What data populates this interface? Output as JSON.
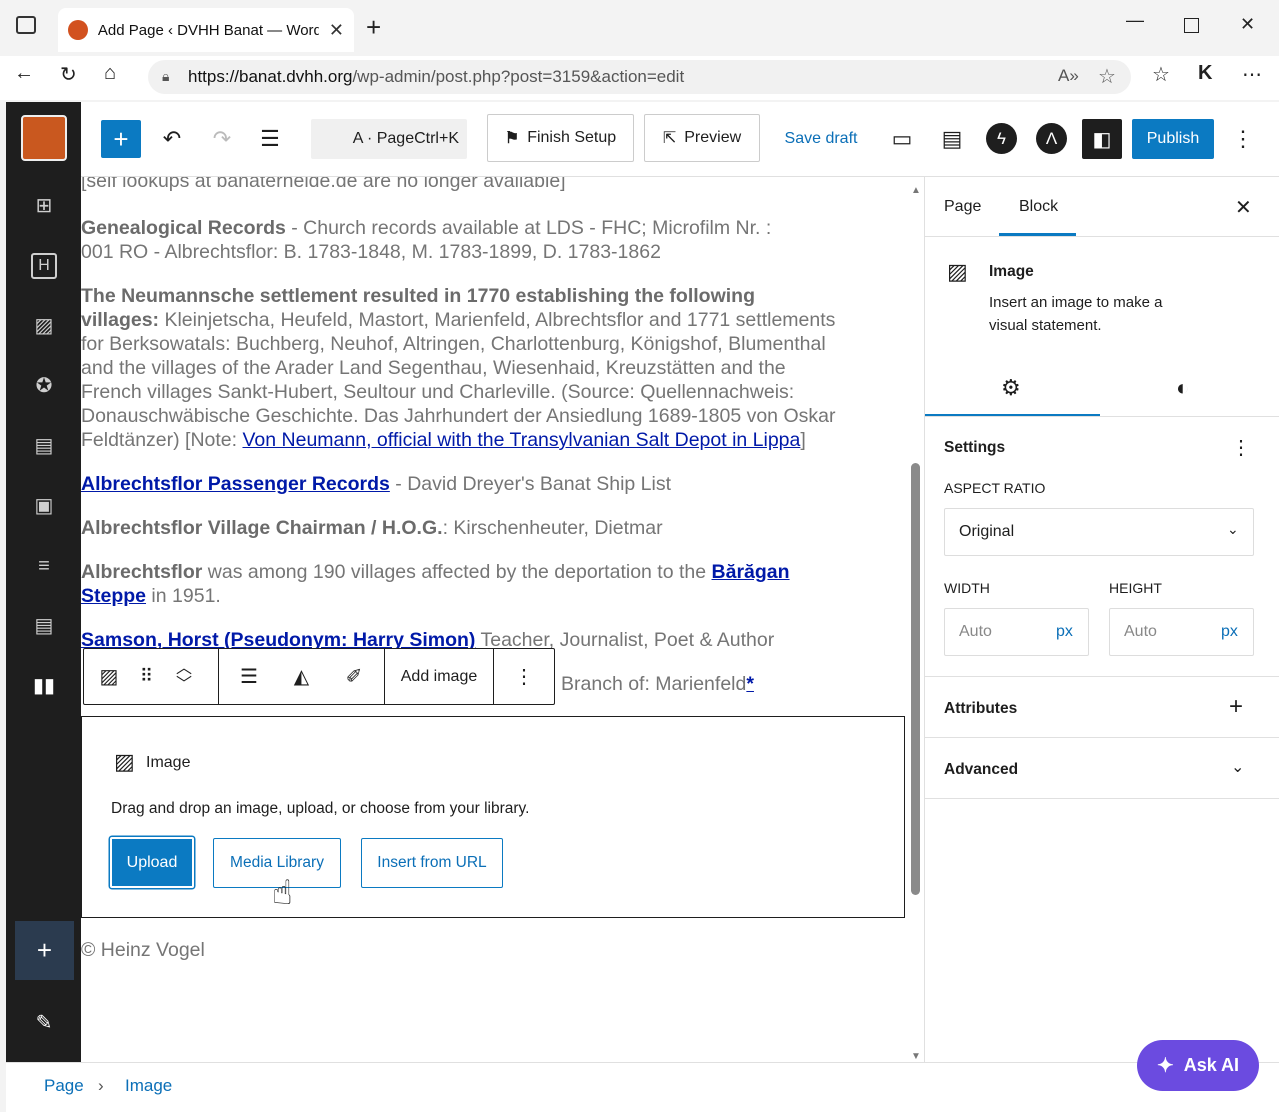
{
  "browser": {
    "tab_title": "Add Page ‹ DVHH Banat — WordPress",
    "url_host": "https://banat.dvhh.org",
    "url_path": "/wp-admin/post.php?post=3159&action=edit"
  },
  "toolbar": {
    "command": "A · PageCtrl+K",
    "finish_setup": "Finish Setup",
    "preview": "Preview",
    "save_draft": "Save draft",
    "publish": "Publish"
  },
  "content": {
    "p0": "[self lookups at banaterheide.de are no longer available]",
    "p1_bold": "Genealogical Records",
    "p1_line1": " - Church records available at LDS - FHC; Microfilm Nr. :",
    "p1_line2": "001 RO - Albrechtsflor: B. 1783-1848, M. 1783-1899, D. 1783-1862",
    "p2_bold1": "The Neumannsche settlement resulted in 1770 establishing the following",
    "p2_bold2": "villages:",
    "p2_text1": " Kleinjetscha, Heufeld, Mastort, Marienfeld, Albrechtsflor and 1771 settlements",
    "p2_text2": "for Berksowatals: Buchberg, Neuhof, Altringen, Charlottenburg, Königshof, Blumenthal",
    "p2_text3": "and the villages of the Arader Land Segenthau, Wiesenhaid, Kreuzstätten and the",
    "p2_text4": "French villages Sankt-Hubert, Seultour und Charleville. (Source: Quellennachweis:",
    "p2_text5": "Donauschwäbische Geschichte. Das Jahrhundert der Ansiedlung 1689-1805 von Oskar",
    "p2_text6": "Feldtänzer) [Note: ",
    "p2_link": "Von Neumann, official with the Transylvanian Salt Depot in Lippa",
    "p2_end": "]",
    "p3_link": "Albrechtsflor Passenger Records",
    "p3_text": " - David Dreyer's Banat Ship List",
    "p4_bold": "Albrechtsflor Village Chairman / H.O.G.",
    "p4_text": ": Kirschenheuter, Dietmar",
    "p5_bold": "Albrechtsflor",
    "p5_text": " was among 190 villages affected by the deportation to the ",
    "p5_link1": "Bărăgan ",
    "p5_link2": "Steppe",
    "p5_end": " in 1951.",
    "p6_link": "Samson, Horst (Pseudonym: Harry Simon)",
    "p6_text": " Teacher, Journalist, Poet & Author",
    "p7_text": "Branch of: Marienfeld",
    "p7_link": "*",
    "footer": "© Heinz Vogel"
  },
  "block_toolbar": {
    "add_image": "Add image"
  },
  "image_block": {
    "title": "Image",
    "instructions": "Drag and drop an image, upload, or choose from your library.",
    "upload": "Upload",
    "media_library": "Media Library",
    "insert_url": "Insert from URL"
  },
  "sidebar": {
    "tab_page": "Page",
    "tab_block": "Block",
    "block_name": "Image",
    "block_desc_1": "Insert an image to make a",
    "block_desc_2": "visual statement.",
    "settings": "Settings",
    "aspect_ratio_label": "ASPECT RATIO",
    "aspect_ratio_value": "Original",
    "width_label": "WIDTH",
    "height_label": "HEIGHT",
    "width_placeholder": "Auto",
    "height_placeholder": "Auto",
    "unit": "px",
    "attributes": "Attributes",
    "advanced": "Advanced"
  },
  "breadcrumb": {
    "page": "Page",
    "sep": "›",
    "image": "Image"
  },
  "ask_ai": "Ask AI"
}
